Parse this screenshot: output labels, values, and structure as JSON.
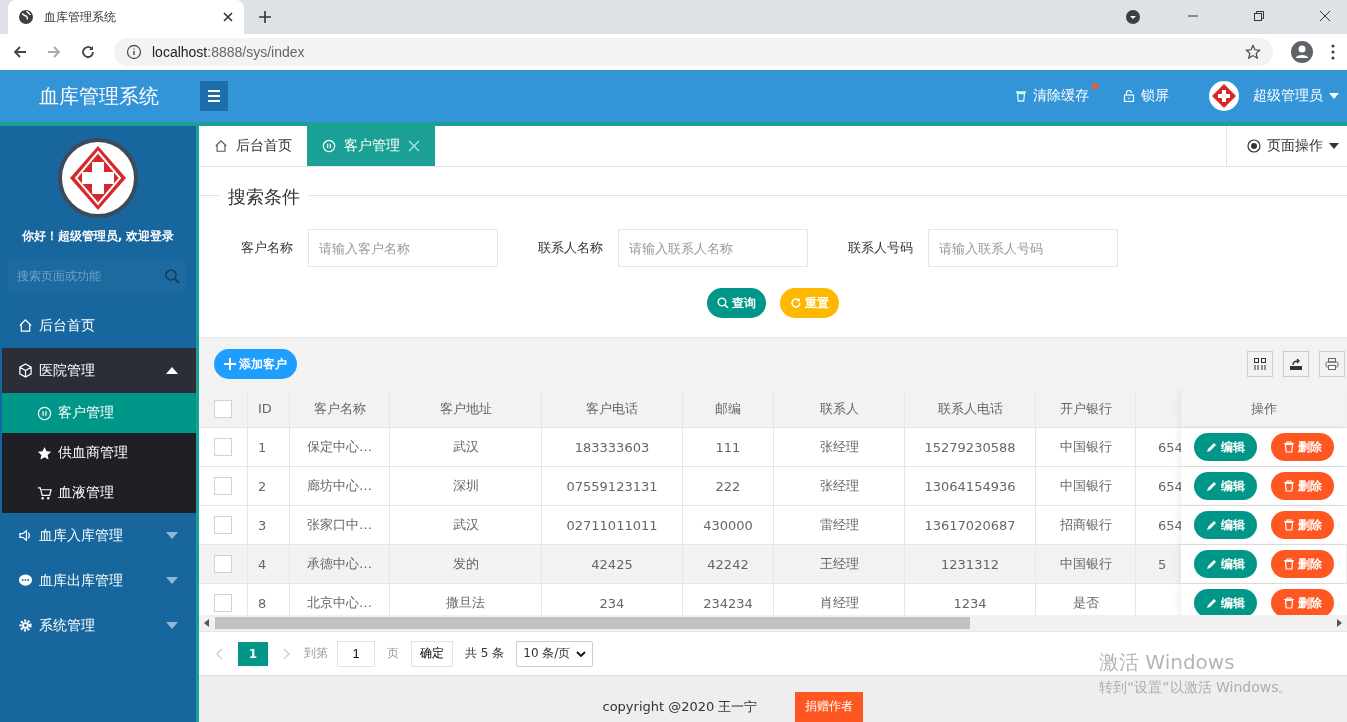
{
  "browser": {
    "tab_title": "血库管理系统",
    "url_host": "localhost",
    "url_rest": ":8888/sys/index"
  },
  "header": {
    "title": "血库管理系统",
    "clear_cache": "清除缓存",
    "clear_cache_dot": true,
    "lock": "锁屏",
    "user": "超级管理员"
  },
  "sidebar": {
    "greeting": "你好！超级管理员, 欢迎登录",
    "search_placeholder": "搜索页面或功能",
    "menu": [
      {
        "label": "后台首页"
      },
      {
        "label": "医院管理",
        "expanded": true,
        "children": [
          {
            "label": "客户管理",
            "selected": true
          },
          {
            "label": "供血商管理",
            "selected": false
          },
          {
            "label": "血液管理",
            "selected": false
          }
        ]
      },
      {
        "label": "血库入库管理",
        "expanded": false
      },
      {
        "label": "血库出库管理",
        "expanded": false
      },
      {
        "label": "系统管理",
        "expanded": false
      }
    ]
  },
  "tabs": [
    {
      "label": "后台首页",
      "selected": false
    },
    {
      "label": "客户管理",
      "selected": true
    }
  ],
  "page_ops": "页面操作",
  "search": {
    "legend": "搜索条件",
    "fields": [
      {
        "label": "客户名称",
        "placeholder": "请输入客户名称"
      },
      {
        "label": "联系人名称",
        "placeholder": "请输入联系人名称"
      },
      {
        "label": "联系人号码",
        "placeholder": "请输入联系人号码"
      }
    ],
    "query_button": "查询",
    "reset_button": "重置"
  },
  "add_button": "添加客户",
  "table": {
    "select_all_checked": false,
    "columns": [
      "ID",
      "客户名称",
      "客户地址",
      "客户电话",
      "邮编",
      "联系人",
      "联系人电话",
      "开户银行"
    ],
    "actions_column": "操作",
    "rows": [
      {
        "checked": false,
        "highlighted": false,
        "cells": [
          "1",
          "保定中心…",
          "武汉",
          "183333603",
          "111",
          "张经理",
          "15279230588",
          "中国银行"
        ],
        "column_9": "654",
        "actions": [
          "编辑",
          "删除"
        ]
      },
      {
        "checked": false,
        "highlighted": false,
        "cells": [
          "2",
          "廊坊中心…",
          "深圳",
          "07559123131",
          "222",
          "张经理",
          "13064154936",
          "中国银行"
        ],
        "column_9": "654",
        "actions": [
          "编辑",
          "删除"
        ]
      },
      {
        "checked": false,
        "highlighted": false,
        "cells": [
          "3",
          "张家口中…",
          "武汉",
          "02711011011",
          "430000",
          "雷经理",
          "13617020687",
          "招商银行"
        ],
        "column_9": "654",
        "actions": [
          "编辑",
          "删除"
        ]
      },
      {
        "checked": false,
        "highlighted": true,
        "cells": [
          "4",
          "承德中心…",
          "发的",
          "42425",
          "42242",
          "王经理",
          "1231312",
          "中国银行"
        ],
        "column_9": "5",
        "actions": [
          "编辑",
          "删除"
        ]
      },
      {
        "checked": false,
        "highlighted": false,
        "cells": [
          "8",
          "北京中心…",
          "撒旦法",
          "234",
          "234234",
          "肖经理",
          "1234",
          "是否"
        ],
        "actions": [
          "编辑",
          "删除"
        ]
      }
    ]
  },
  "pagination": {
    "current": "1",
    "goto": "到第",
    "page_input": "1",
    "page_unit": "页",
    "confirm": "确定",
    "total": "共 5 条",
    "page_size": "10 条/页"
  },
  "footer": {
    "copyright": "copyright @2020 王一宁",
    "donate": "捐赠作者"
  },
  "os_notice": {
    "title": "激活 Windows",
    "text": "转到“设置”以激活 Windows。"
  }
}
